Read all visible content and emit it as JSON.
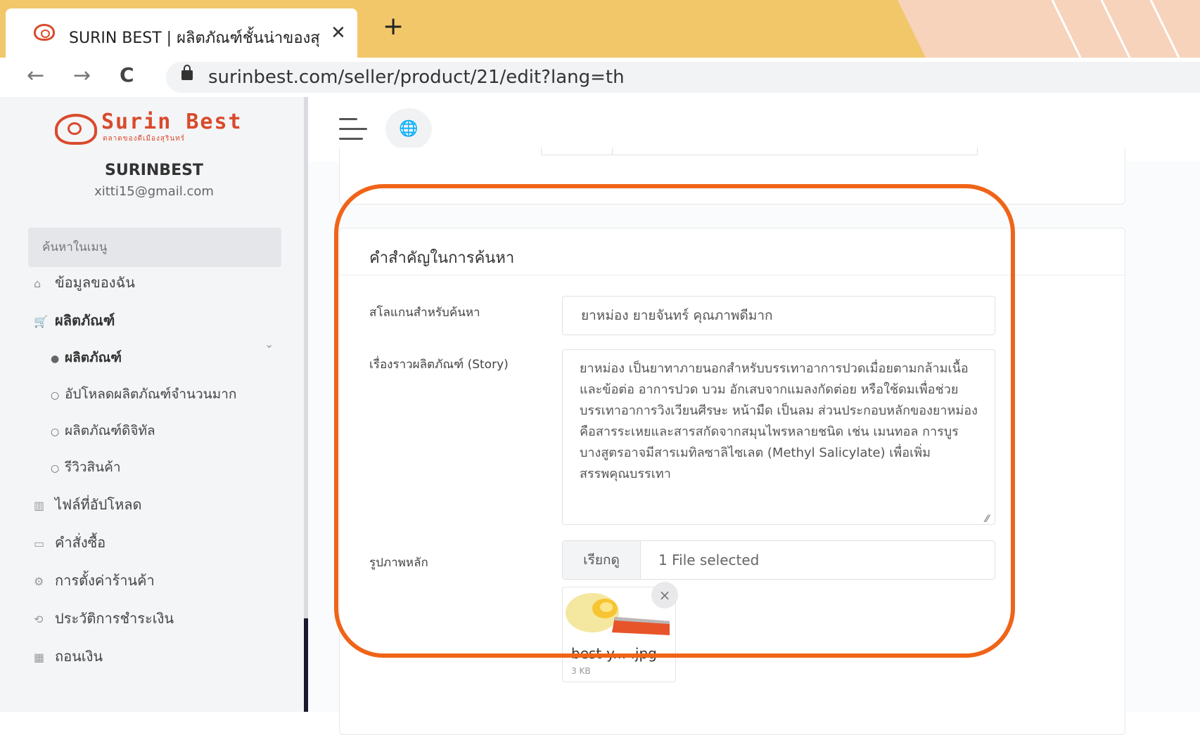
{
  "browser": {
    "tab_title": "SURIN BEST | ผลิตภัณฑ์ชั้นน่าของสุ",
    "tab_close": "✕",
    "new_tab": "+",
    "url": "surinbest.com/seller/product/21/edit?lang=th",
    "back": "←",
    "forward": "→",
    "reload": "C"
  },
  "sidebar": {
    "logo_text": "Surin Best",
    "logo_sub": "ตลาดของดีเมืองสุรินทร์",
    "store_name": "SURINBEST",
    "store_email": "xitti15@gmail.com",
    "search_placeholder": "ค้นหาในเมนู",
    "items": [
      {
        "label": "ข้อมูลของฉัน",
        "icon": "⌂"
      },
      {
        "label": "ผลิตภัณฑ์",
        "icon": "🛒"
      },
      {
        "label": "ไฟล์ที่อัปโหลด",
        "icon": "▥"
      },
      {
        "label": "คำสั่งซื้อ",
        "icon": "▭"
      },
      {
        "label": "การตั้งค่าร้านค้า",
        "icon": "⚙"
      },
      {
        "label": "ประวัติการชำระเงิน",
        "icon": "⟲"
      },
      {
        "label": "ถอนเงิน",
        "icon": "▦"
      }
    ],
    "subitems": [
      {
        "label": "ผลิตภัณฑ์",
        "bullet": "●"
      },
      {
        "label": "อัปโหลดผลิตภัณฑ์จำนวนมาก",
        "bullet": "○"
      },
      {
        "label": "ผลิตภัณฑ์ดิจิทัล",
        "bullet": "○"
      },
      {
        "label": "รีวิวสินค้า",
        "bullet": "○"
      }
    ],
    "chevron": "⌄"
  },
  "header": {
    "globe": "🌐"
  },
  "form": {
    "section_title": "คำสำคัญในการค้นหา",
    "slogan_label": "สโลแกนสำหรับค้นหา",
    "slogan_value": "ยาหม่อง ยายจันทร์ คุณภาพดีมาก",
    "story_label": "เรื่องราวผลิตภัณฑ์ (Story)",
    "story_value": "ยาหม่อง เป็นยาทาภายนอกสำหรับบรรเทาอาการปวดเมื่อยตามกล้ามเนื้อและข้อต่อ อาการปวด บวม อักเสบจากแมลงกัดต่อย หรือใช้ดมเพื่อช่วยบรรเทาอาการวิงเวียนศีรษะ หน้ามืด เป็นลม ส่วนประกอบหลักของยาหม่องคือสารระเหยและสารสกัดจากสมุนไพรหลายชนิด เช่น เมนทอล การบูร บางสูตรอาจมีสารเมทิลซาลิไซเลต (Methyl Salicylate) เพื่อเพิ่มสรรพคุณบรรเทา",
    "main_image_label": "รูปภาพหลัก",
    "browse_label": "เรียกดู",
    "file_status": "1 File selected",
    "thumb_name": "best-y... .jpg",
    "thumb_size": "3 KB",
    "thumb_remove": "×"
  },
  "colors": {
    "tab_strip": "#f2c76a",
    "highlight": "#f06418",
    "brand": "#d94a2b"
  }
}
